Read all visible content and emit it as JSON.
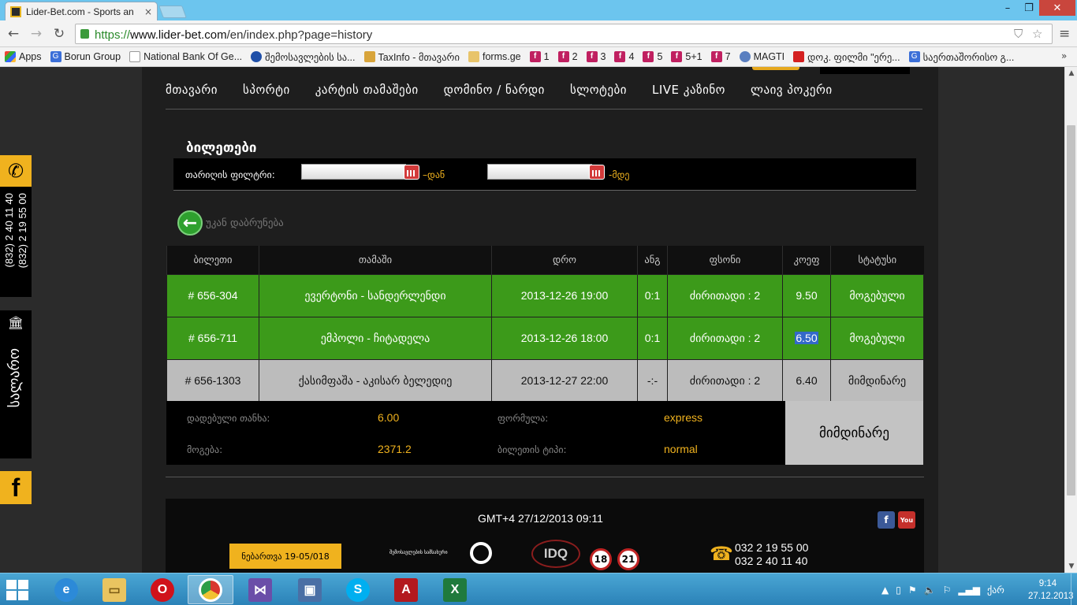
{
  "browser": {
    "tab_title": "Lider-Bet.com - Sports an",
    "tab_close": "×",
    "url_scheme": "https://",
    "url_domain": "www.lider-bet.com",
    "url_path": "/en/index.php?page=history",
    "window_controls": [
      "–",
      "❐",
      "✕"
    ]
  },
  "bookmarks": [
    {
      "label": "Apps",
      "icon": "apps-icon"
    },
    {
      "label": "Borun Group",
      "icon": "g-icon"
    },
    {
      "label": "National Bank Of Ge...",
      "icon": "page-icon"
    },
    {
      "label": "შემოსავლების სა...",
      "icon": "rs-icon"
    },
    {
      "label": "TaxInfo - მთავარი",
      "icon": "taxinfo-icon"
    },
    {
      "label": "forms.ge",
      "icon": "forms-icon"
    },
    {
      "label": "1",
      "icon": "f-icon"
    },
    {
      "label": "2",
      "icon": "f-icon"
    },
    {
      "label": "3",
      "icon": "f-icon"
    },
    {
      "label": "4",
      "icon": "f-icon"
    },
    {
      "label": "5",
      "icon": "f-icon"
    },
    {
      "label": "5+1",
      "icon": "f-icon"
    },
    {
      "label": "7",
      "icon": "f-icon"
    },
    {
      "label": "MAGTI",
      "icon": "magti-icon"
    },
    {
      "label": "დოკ. ფილმი \"ერე...",
      "icon": "youtube-icon"
    },
    {
      "label": "საერთაშორისო გ...",
      "icon": "g-icon"
    }
  ],
  "nav": [
    "მთავარი",
    "სპორტი",
    "კარტის თამაშები",
    "დომინო / ნარდი",
    "სლოტები",
    "LIVE კაზინო",
    "ლაივ პოკერი"
  ],
  "page": {
    "title": "ბილეთები",
    "filter_label": "თარიღის ფილტრი:",
    "from_suffix": "–დან",
    "to_suffix": "-მდე",
    "from_value": "",
    "to_value": "",
    "back_label": "უკან დაბრუნება"
  },
  "table": {
    "headers": [
      "ბილეთი",
      "თამაში",
      "დრო",
      "ანგ",
      "ფსონი",
      "კოეფ",
      "სტატუსი"
    ],
    "rows": [
      {
        "ticket": "# 656-304",
        "game": "ევერტონი - სანდერლენდი",
        "time": "2013-12-26 19:00",
        "score": "0:1",
        "bet": "ძირითადი : 2",
        "odds": "9.50",
        "status": "მოგებული",
        "state": "won"
      },
      {
        "ticket": "# 656-711",
        "game": "ემპოლი - ჩიტადელა",
        "time": "2013-12-26 18:00",
        "score": "0:1",
        "bet": "ძირითადი : 2",
        "odds": "6.50",
        "status": "მოგებული",
        "state": "won"
      },
      {
        "ticket": "# 656-1303",
        "game": "ქასიმფაშა - აკისარ ბელედიე",
        "time": "2013-12-27 22:00",
        "score": "-:-",
        "bet": "ძირითადი : 2",
        "odds": "6.40",
        "status": "მიმდინარე",
        "state": "current"
      }
    ]
  },
  "summary": {
    "stake_label": "დადებული თანხა:",
    "stake_value": "6.00",
    "win_label": "მოგება:",
    "win_value": "2371.2",
    "formula_label": "ფორმულა:",
    "formula_value": "express",
    "type_label": "ბილეთის ტიპი:",
    "type_value": "normal",
    "status": "მიმდინარე"
  },
  "footer": {
    "gmt": "GMT+4 27/12/2013 09:11",
    "license": "ნებართვა 19-05/018",
    "revenue_logo": "შემოსავლების სამსახური",
    "idq": "IDQ",
    "age1": "18",
    "age2": "21",
    "phone1": "032 2 19 55 00",
    "phone2": "032 2 40 11 40"
  },
  "side": {
    "phone1": "(832) 2 40 11 40",
    "phone2": "(832) 2 19 55 00",
    "cashier": "სალარო",
    "facebook": "f"
  },
  "taskbar": {
    "time": "9:14",
    "date": "27.12.2013",
    "lang": "ქარ"
  },
  "colors": {
    "accent": "#f0b21e",
    "won_row": "#3c9a1a",
    "current_row": "#bcbcbc",
    "titlebar": "#6cc5ee",
    "taskbar": "#2b82b8"
  }
}
